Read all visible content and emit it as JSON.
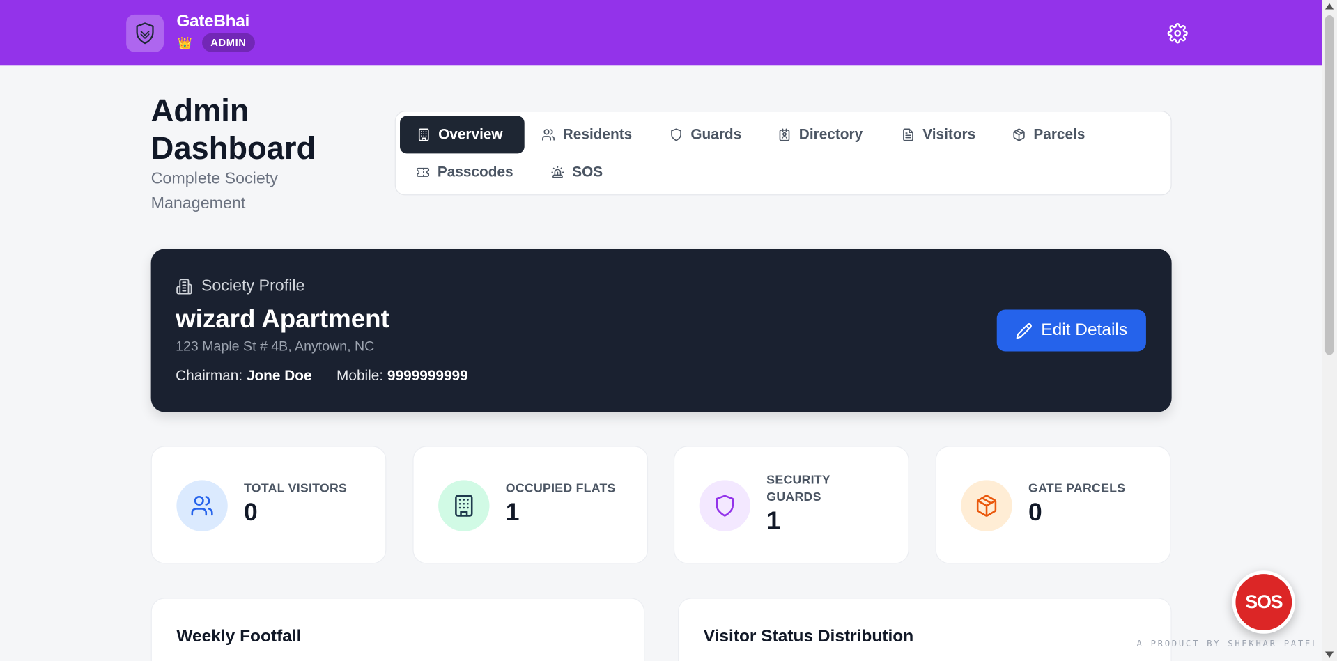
{
  "header": {
    "brand": "GateBhai",
    "role_badge": "ADMIN",
    "crown": "👑"
  },
  "page": {
    "title": "Admin Dashboard",
    "subtitle": "Complete Society Management"
  },
  "tabs": [
    {
      "label": "Overview",
      "icon": "building-icon",
      "active": true
    },
    {
      "label": "Residents",
      "icon": "users-icon",
      "active": false
    },
    {
      "label": "Guards",
      "icon": "shield-icon",
      "active": false
    },
    {
      "label": "Directory",
      "icon": "contact-card-icon",
      "active": false
    },
    {
      "label": "Visitors",
      "icon": "document-icon",
      "active": false
    },
    {
      "label": "Parcels",
      "icon": "package-icon",
      "active": false
    },
    {
      "label": "Passcodes",
      "icon": "ticket-icon",
      "active": false
    },
    {
      "label": "SOS",
      "icon": "siren-icon",
      "active": false
    }
  ],
  "profile": {
    "label": "Society Profile",
    "name": "wizard Apartment",
    "address": "123 Maple St # 4B, Anytown, NC",
    "chairman_label": "Chairman:",
    "chairman": "Jone Doe",
    "mobile_label": "Mobile:",
    "mobile": "9999999999",
    "edit_label": "Edit Details"
  },
  "stats": [
    {
      "label": "TOTAL VISITORS",
      "value": "0",
      "icon": "users-icon",
      "color": "#2563eb",
      "bg": "#dbeafe"
    },
    {
      "label": "OCCUPIED FLATS",
      "value": "1",
      "icon": "building-icon",
      "color": "#1f3a4d",
      "bg": "#d1fae5"
    },
    {
      "label": "SECURITY GUARDS",
      "value": "1",
      "icon": "shield-icon",
      "color": "#9333ea",
      "bg": "#f3e8ff"
    },
    {
      "label": "GATE PARCELS",
      "value": "0",
      "icon": "package-icon",
      "color": "#ea580c",
      "bg": "#ffedd5"
    }
  ],
  "panels": {
    "weekly_footfall": "Weekly Footfall",
    "status_distribution": "Visitor Status Distribution"
  },
  "sos_button": "SOS",
  "credit": "A PRODUCT BY SHEKHAR PATEL",
  "colors": {
    "topbar": "#9333ea",
    "active_tab": "#1e2633",
    "profile_card": "#1a2130",
    "primary_button": "#2563eb",
    "sos": "#dc2626"
  }
}
